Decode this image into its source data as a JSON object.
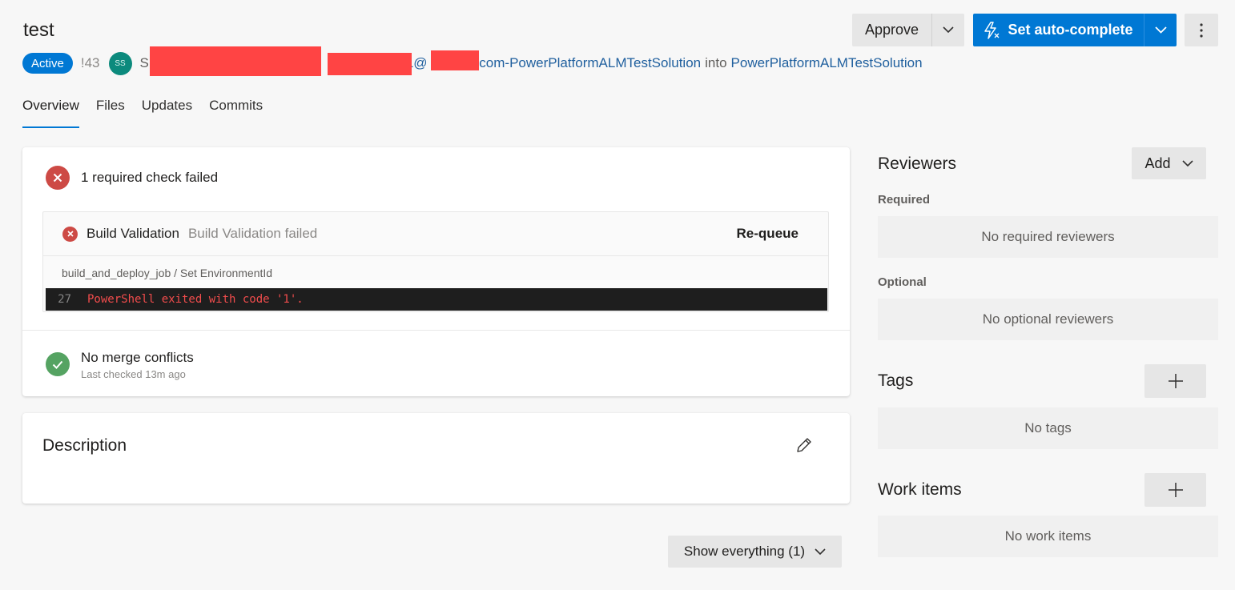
{
  "header": {
    "title": "test",
    "status_badge": "Active",
    "pr_id": "!43",
    "avatar_initials": "SS",
    "author_prefix": "S",
    "source_branch_suffix": "1@",
    "source_branch_tail": ".com-PowerPlatformALMTestSolution",
    "into_label": "into",
    "target_branch": "PowerPlatformALMTestSolution"
  },
  "actions": {
    "approve_label": "Approve",
    "auto_complete_label": "Set auto-complete"
  },
  "tabs": [
    {
      "label": "Overview",
      "active": true
    },
    {
      "label": "Files",
      "active": false
    },
    {
      "label": "Updates",
      "active": false
    },
    {
      "label": "Commits",
      "active": false
    }
  ],
  "status_card": {
    "summary": "1 required check failed",
    "check": {
      "name": "Build Validation",
      "status": "Build Validation failed",
      "requeue_label": "Re-queue",
      "path": "build_and_deploy_job / Set EnvironmentId",
      "log_line_number": "27",
      "log_message": "PowerShell exited with code '1'."
    },
    "merge": {
      "title": "No merge conflicts",
      "subtitle": "Last checked 13m ago"
    }
  },
  "description": {
    "title": "Description"
  },
  "show_everything_label": "Show everything (1)",
  "sidebar": {
    "reviewers_title": "Reviewers",
    "add_label": "Add",
    "required_label": "Required",
    "required_empty": "No required reviewers",
    "optional_label": "Optional",
    "optional_empty": "No optional reviewers",
    "tags_title": "Tags",
    "tags_empty": "No tags",
    "work_items_title": "Work items",
    "work_items_empty": "No work items"
  },
  "colors": {
    "accent": "#0078d4",
    "error": "#cd4a45",
    "success": "#55a362",
    "link": "#1f5f9e"
  }
}
